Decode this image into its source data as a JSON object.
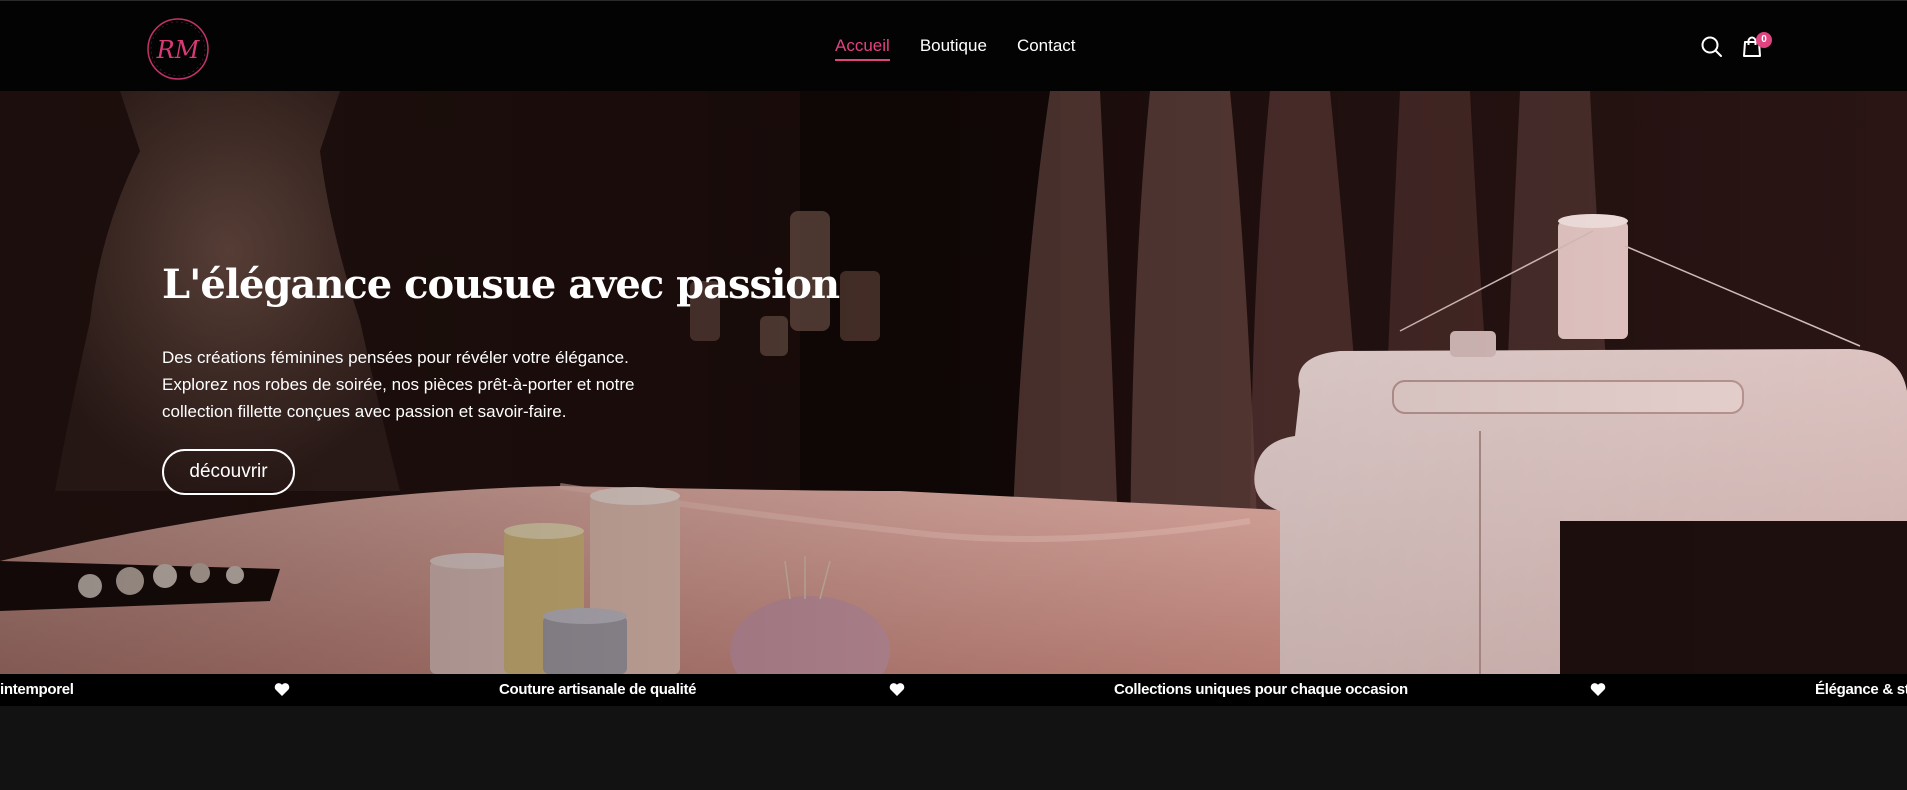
{
  "header": {
    "logo_text": "RM",
    "nav": [
      {
        "label": "Accueil",
        "active": true
      },
      {
        "label": "Boutique",
        "active": false
      },
      {
        "label": "Contact",
        "active": false
      }
    ],
    "search_icon": "search-icon",
    "cart_icon": "shopping-bag-icon",
    "cart_count": "0",
    "accent_color": "#e0437f"
  },
  "hero": {
    "title": "L'élégance cousue avec passion",
    "text_lines": [
      "Des créations féminines pensées pour révéler votre élégance.",
      "Explorez nos robes de soirée, nos pièces prêt-à-porter et notre",
      "collection fillette conçues avec passion et savoir-faire."
    ],
    "cta_label": "découvrir"
  },
  "marquee": {
    "items": [
      "intemporel",
      "Couture artisanale de qualité",
      "Collections uniques pour chaque occasion",
      "Élégance & sty"
    ],
    "separator_icon": "heart-icon"
  }
}
